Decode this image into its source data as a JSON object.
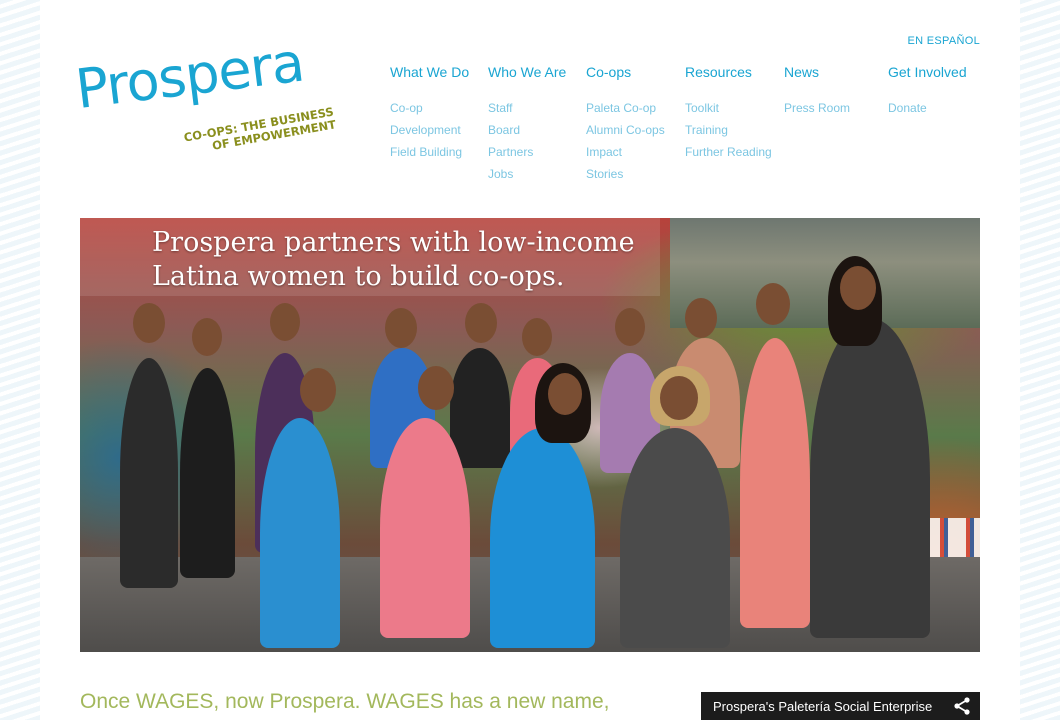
{
  "header": {
    "language_link": "EN ESPAÑOL",
    "logo_name": "Prospera",
    "logo_tagline_line1": "CO-OPS: THE BUSINESS",
    "logo_tagline_line2": "OF EMPOWERMENT"
  },
  "nav": [
    {
      "label": "What We Do",
      "items": [
        "Co-op",
        "Development",
        "Field Building"
      ]
    },
    {
      "label": "Who We Are",
      "items": [
        "Staff",
        "Board",
        "Partners",
        "Jobs"
      ]
    },
    {
      "label": "Co-ops",
      "items": [
        "Paleta Co-op",
        "Alumni Co-ops",
        "Impact",
        "Stories"
      ]
    },
    {
      "label": "Resources",
      "items": [
        "Toolkit",
        "Training",
        "Further Reading"
      ]
    },
    {
      "label": "News",
      "items": [
        "Press Room"
      ]
    },
    {
      "label": "Get Involved",
      "items": [
        "Donate"
      ]
    }
  ],
  "hero": {
    "caption_line1": "Prospera partners with low-income",
    "caption_line2": "Latina women to build co-ops."
  },
  "main": {
    "intro": "Once WAGES, now Prospera. WAGES has a new name,"
  },
  "video": {
    "title": "Prospera's Paletería Social Enterprise",
    "icon": "share-icon"
  },
  "colors": {
    "brand_blue": "#1aa5d2",
    "brand_olive": "#8a8f1e",
    "intro_green": "#a3b85c"
  }
}
